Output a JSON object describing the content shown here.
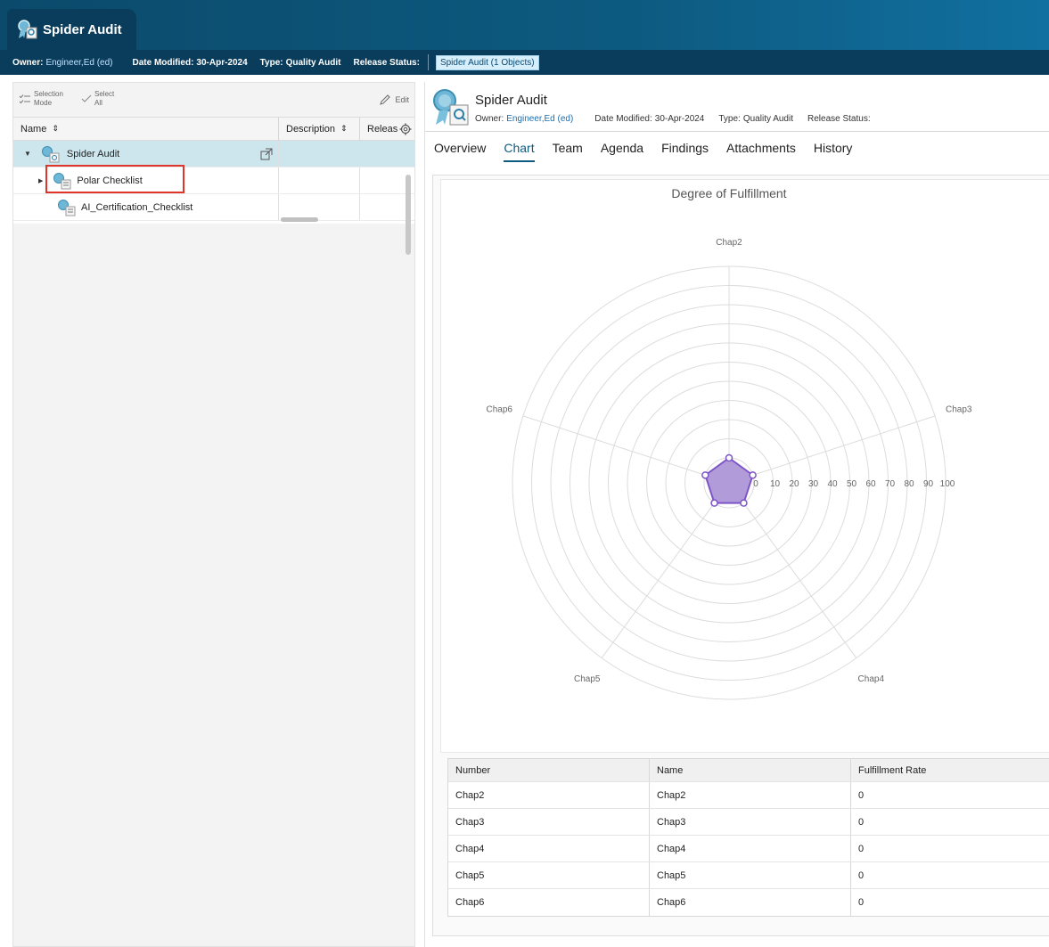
{
  "header": {
    "app_title": "Spider Audit",
    "owner_label": "Owner:",
    "owner_value": "Engineer,Ed (ed)",
    "date_label": "Date Modified:",
    "date_value": "30-Apr-2024",
    "type_label": "Type:",
    "type_value": "Quality Audit",
    "release_label": "Release Status:",
    "badge": "Spider Audit (1 Objects)"
  },
  "left": {
    "toolbar": {
      "selection_mode_1": "Selection",
      "selection_mode_2": "Mode",
      "select_all_1": "Select",
      "select_all_2": "All",
      "edit": "Edit"
    },
    "columns": {
      "name": "Name",
      "description": "Description",
      "release": "Releas"
    },
    "rows": [
      {
        "label": "Spider Audit"
      },
      {
        "label": "Polar Checklist"
      },
      {
        "label": "AI_Certification_Checklist"
      }
    ]
  },
  "right": {
    "title": "Spider Audit",
    "owner_label": "Owner:",
    "owner_value": "Engineer,Ed (ed)",
    "date_label": "Date Modified:",
    "date_value": "30-Apr-2024",
    "type_label": "Type:",
    "type_value": "Quality Audit",
    "release_label": "Release Status:",
    "tabs": [
      "Overview",
      "Chart",
      "Team",
      "Agenda",
      "Findings",
      "Attachments",
      "History"
    ],
    "active_tab": "Chart",
    "table": {
      "headers": [
        "Number",
        "Name",
        "Fulfillment Rate"
      ],
      "rows": [
        [
          "Chap2",
          "Chap2",
          "0"
        ],
        [
          "Chap3",
          "Chap3",
          "0"
        ],
        [
          "Chap4",
          "Chap4",
          "0"
        ],
        [
          "Chap5",
          "Chap5",
          "0"
        ],
        [
          "Chap6",
          "Chap6",
          "0"
        ]
      ]
    }
  },
  "chart_data": {
    "type": "radar",
    "title": "Degree of Fulfillment",
    "categories": [
      "Chap2",
      "Chap3",
      "Chap4",
      "Chap5",
      "Chap6"
    ],
    "values": [
      0,
      0,
      0,
      0,
      0
    ],
    "rlim": [
      0,
      100
    ],
    "ticks": [
      "0",
      "10",
      "20",
      "30",
      "40",
      "50",
      "60",
      "70",
      "80",
      "90",
      "100"
    ],
    "fill_color": "#b19cd9",
    "stroke_color": "#7d55c7"
  },
  "colors": {
    "header_bg": "#0b4a6b",
    "accent": "#0d5a80",
    "highlight_box": "#e0352b"
  }
}
